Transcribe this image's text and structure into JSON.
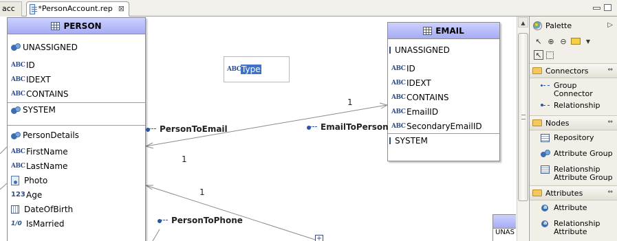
{
  "tabs": [
    {
      "label": "acc"
    },
    {
      "label": "*PersonAccount.rep",
      "close": "⊠"
    }
  ],
  "entities": {
    "person": {
      "title": "PERSON",
      "groups": [
        [
          {
            "icon": "attribute-group-icon",
            "label": "UNASSIGNED"
          }
        ],
        [
          {
            "icon": "abc-icon",
            "label": "ID"
          },
          {
            "icon": "abc-icon",
            "label": "IDEXT"
          },
          {
            "icon": "abc-icon",
            "label": "CONTAINS"
          }
        ],
        [
          {
            "icon": "attribute-group-icon",
            "label": "SYSTEM"
          }
        ],
        [
          {
            "icon": "attribute-group-icon",
            "label": "PersonDetails"
          },
          {
            "icon": "abc-icon",
            "label": "FirstName"
          },
          {
            "icon": "abc-icon",
            "label": "LastName"
          },
          {
            "icon": "photo-icon",
            "label": "Photo"
          },
          {
            "icon": "number-icon",
            "label": "Age"
          },
          {
            "icon": "date-icon",
            "label": "DateOfBirth"
          },
          {
            "icon": "boolean-icon",
            "label": "IsMarried"
          }
        ]
      ]
    },
    "email": {
      "title": "EMAIL",
      "groups": [
        [
          {
            "icon": "dash-icon",
            "label": "UNASSIGNED"
          }
        ],
        [
          {
            "icon": "abc-icon",
            "label": "ID"
          },
          {
            "icon": "abc-icon",
            "label": "IDEXT"
          },
          {
            "icon": "abc-icon",
            "label": "CONTAINS"
          },
          {
            "icon": "abc-icon",
            "label": "EmailID"
          },
          {
            "icon": "abc-icon",
            "label": "SecondaryEmailID"
          }
        ],
        [
          {
            "icon": "dash-icon",
            "label": "SYSTEM"
          }
        ]
      ]
    }
  },
  "floating_attribute": {
    "icon_text": "ABC",
    "label": "Type"
  },
  "relationships": [
    {
      "name": "PersonToEmail",
      "card_near": "1",
      "card_far": "1"
    },
    {
      "name": "EmailToPerson"
    },
    {
      "name": "PersonToPhone",
      "card_near": "1"
    }
  ],
  "icon_texts": {
    "abc": "ABC",
    "number": "123",
    "boolean": "1/0",
    "expand": "+"
  },
  "stub_entity_text": "UNAS",
  "palette": {
    "title": "Palette",
    "drawers": [
      {
        "name": "Connectors",
        "items": [
          {
            "icon": "group-connector-icon",
            "label": "Group Connector"
          },
          {
            "icon": "relationship-icon",
            "label": "Relationship"
          }
        ]
      },
      {
        "name": "Nodes",
        "items": [
          {
            "icon": "repository-icon",
            "label": "Repository"
          },
          {
            "icon": "attribute-group-icon",
            "label": "Attribute Group"
          },
          {
            "icon": "relationship-attribute-group-icon",
            "label": "Relationship Attribute Group"
          }
        ]
      },
      {
        "name": "Attributes",
        "items": [
          {
            "icon": "attribute-icon",
            "label": "Attribute"
          },
          {
            "icon": "relationship-attribute-icon",
            "label": "Relationship Attribute"
          }
        ]
      }
    ]
  },
  "colors": {
    "entity_header_top": "#ccd0ff",
    "entity_header_bottom": "#a7acf4",
    "selection": "#3b73c8",
    "link_line": "#8a8a8a",
    "palette_bg": "#f1efe8"
  }
}
